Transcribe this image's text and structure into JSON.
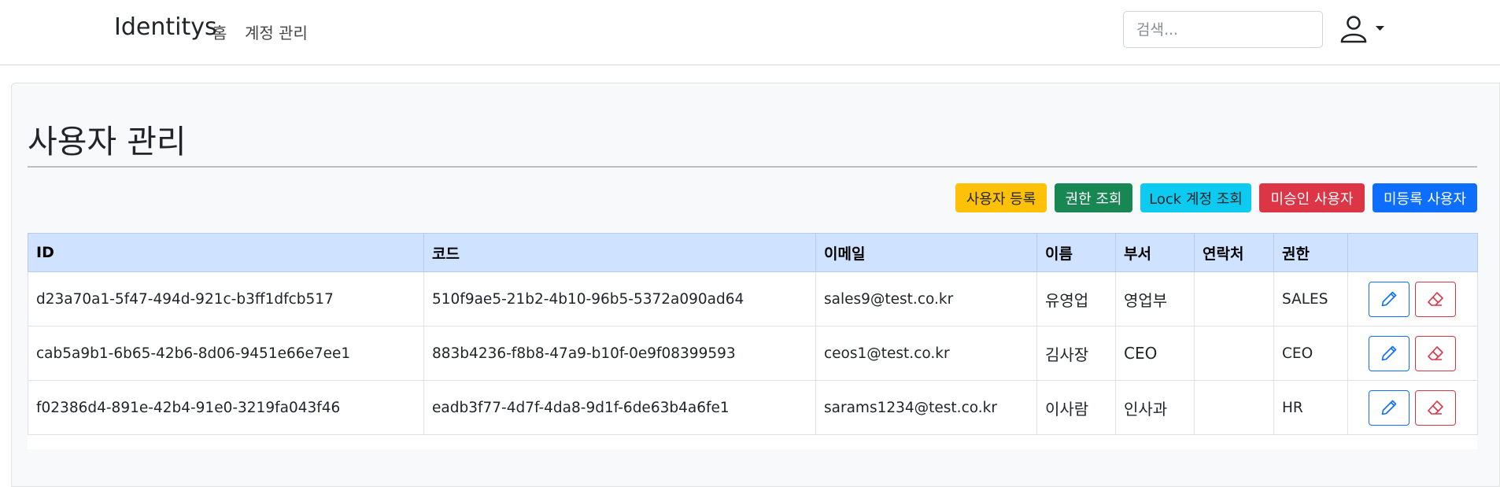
{
  "nav": {
    "brand": "Identitys",
    "home": "홈",
    "account": "계정 관리",
    "search_placeholder": "검색...",
    "user_icon": "person-icon",
    "caret_icon": "caret-down-icon"
  },
  "page": {
    "title": "사용자 관리"
  },
  "actions": {
    "register": "사용자 등록",
    "roles": "권한 조회",
    "lock": "Lock 계정 조회",
    "unapproved": "미승인 사용자",
    "unregistered": "미등록 사용자"
  },
  "table": {
    "headers": [
      "ID",
      "코드",
      "이메일",
      "이름",
      "부서",
      "연락처",
      "권한",
      ""
    ],
    "rows": [
      {
        "id": "d23a70a1-5f47-494d-921c-b3ff1dfcb517",
        "code": "510f9ae5-21b2-4b10-96b5-5372a090ad64",
        "email": "sales9@test.co.kr",
        "name": "유영업",
        "dept": "영업부",
        "contact": "",
        "role": "SALES"
      },
      {
        "id": "cab5a9b1-6b65-42b6-8d06-9451e66e7ee1",
        "code": "883b4236-f8b8-47a9-b10f-0e9f08399593",
        "email": "ceos1@test.co.kr",
        "name": "김사장",
        "dept": "CEO",
        "contact": "",
        "role": "CEO"
      },
      {
        "id": "f02386d4-891e-42b4-91e0-3219fa043f46",
        "code": "eadb3f77-4d7f-4da8-9d1f-6de63b4a6fe1",
        "email": "sarams1234@test.co.kr",
        "name": "이사람",
        "dept": "인사과",
        "contact": "",
        "role": "HR"
      }
    ]
  },
  "icons": {
    "edit": "pencil-icon",
    "delete": "eraser-icon"
  },
  "colors": {
    "warning": "#ffc107",
    "success": "#198754",
    "info": "#0dcaf0",
    "danger": "#dc3545",
    "primary": "#0d6efd",
    "table_header": "#cfe2ff"
  }
}
